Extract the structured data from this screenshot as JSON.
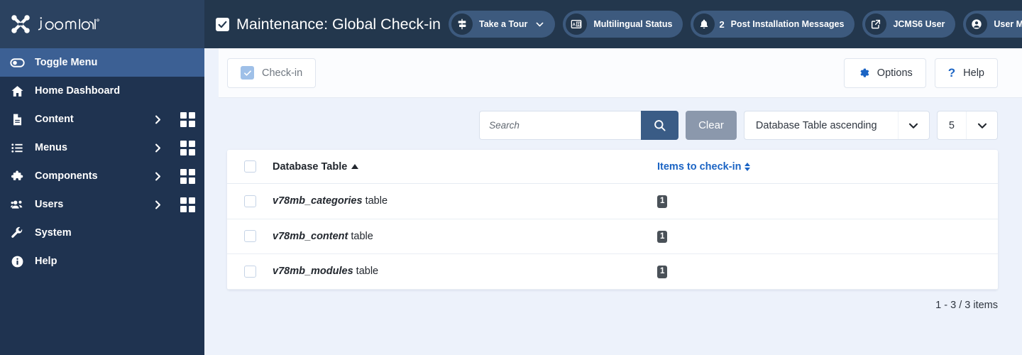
{
  "brand": {
    "name": "Joomla!",
    "logo_icon": "joomla-logo-icon"
  },
  "header": {
    "title": "Maintenance: Global Check-in",
    "title_checkbox_icon": "checkbox-checked-icon",
    "pills": [
      {
        "label": "Take a Tour",
        "icon": "signpost-icon",
        "has_chevron": true,
        "count": null
      },
      {
        "label": "Multilingual Status",
        "icon": "translate-icon",
        "has_chevron": false,
        "count": null
      },
      {
        "label": "Post Installation Messages",
        "icon": "bell-icon",
        "has_chevron": false,
        "count": "2"
      },
      {
        "label": "JCMS6 User",
        "icon": "external-link-icon",
        "has_chevron": false,
        "count": null
      },
      {
        "label": "User Menu",
        "icon": "user-circle-icon",
        "has_chevron": true,
        "count": null
      }
    ],
    "overflow_icon": "ellipsis-icon"
  },
  "sidebar": {
    "toggle": {
      "label": "Toggle Menu",
      "icon": "toggle-switch-icon"
    },
    "items": [
      {
        "label": "Home Dashboard",
        "icon": "home-icon",
        "arrow": false,
        "grid": false
      },
      {
        "label": "Content",
        "icon": "document-icon",
        "arrow": true,
        "grid": true
      },
      {
        "label": "Menus",
        "icon": "list-icon",
        "arrow": true,
        "grid": true
      },
      {
        "label": "Components",
        "icon": "puzzle-icon",
        "arrow": true,
        "grid": true
      },
      {
        "label": "Users",
        "icon": "users-icon",
        "arrow": true,
        "grid": true
      },
      {
        "label": "System",
        "icon": "wrench-icon",
        "arrow": false,
        "grid": false
      },
      {
        "label": "Help",
        "icon": "info-circle-icon",
        "arrow": false,
        "grid": false
      }
    ]
  },
  "toolbar": {
    "checkin_label": "Check-in",
    "checkin_icon": "checkbox-checked-icon",
    "options_label": "Options",
    "options_icon": "gear-icon",
    "help_label": "Help",
    "help_icon": "question-mark-icon"
  },
  "filters": {
    "search_placeholder": "Search",
    "search_value": "",
    "search_icon": "search-icon",
    "clear_label": "Clear",
    "sort_value": "Database Table ascending",
    "limit_value": "5",
    "chevron_icon": "chevron-down-icon"
  },
  "table": {
    "columns": {
      "select_all": "",
      "name": "Database Table",
      "name_sort_icon": "caret-up-icon",
      "items": "Items to check-in",
      "items_sort_icon": "caret-updown-icon"
    },
    "rows": [
      {
        "name": "v78mb_categories",
        "suffix": " table",
        "count": "1",
        "checked": false
      },
      {
        "name": "v78mb_content",
        "suffix": " table",
        "count": "1",
        "checked": false
      },
      {
        "name": "v78mb_modules",
        "suffix": " table",
        "count": "1",
        "checked": false
      }
    ]
  },
  "pagination": {
    "summary": "1 - 3 / 3 items"
  },
  "colors": {
    "header_bg": "#23374d",
    "brand_bg": "#2b4260",
    "sidebar_bg": "#1f3350",
    "toggle_bg": "#3c6094",
    "pill_bg": "#3d5a7e",
    "content_bg": "#edf2fb",
    "accent_link": "#1b64c4",
    "search_btn": "#3a5c86",
    "clear_btn": "#8b98ac",
    "badge_bg": "#4a5158"
  }
}
